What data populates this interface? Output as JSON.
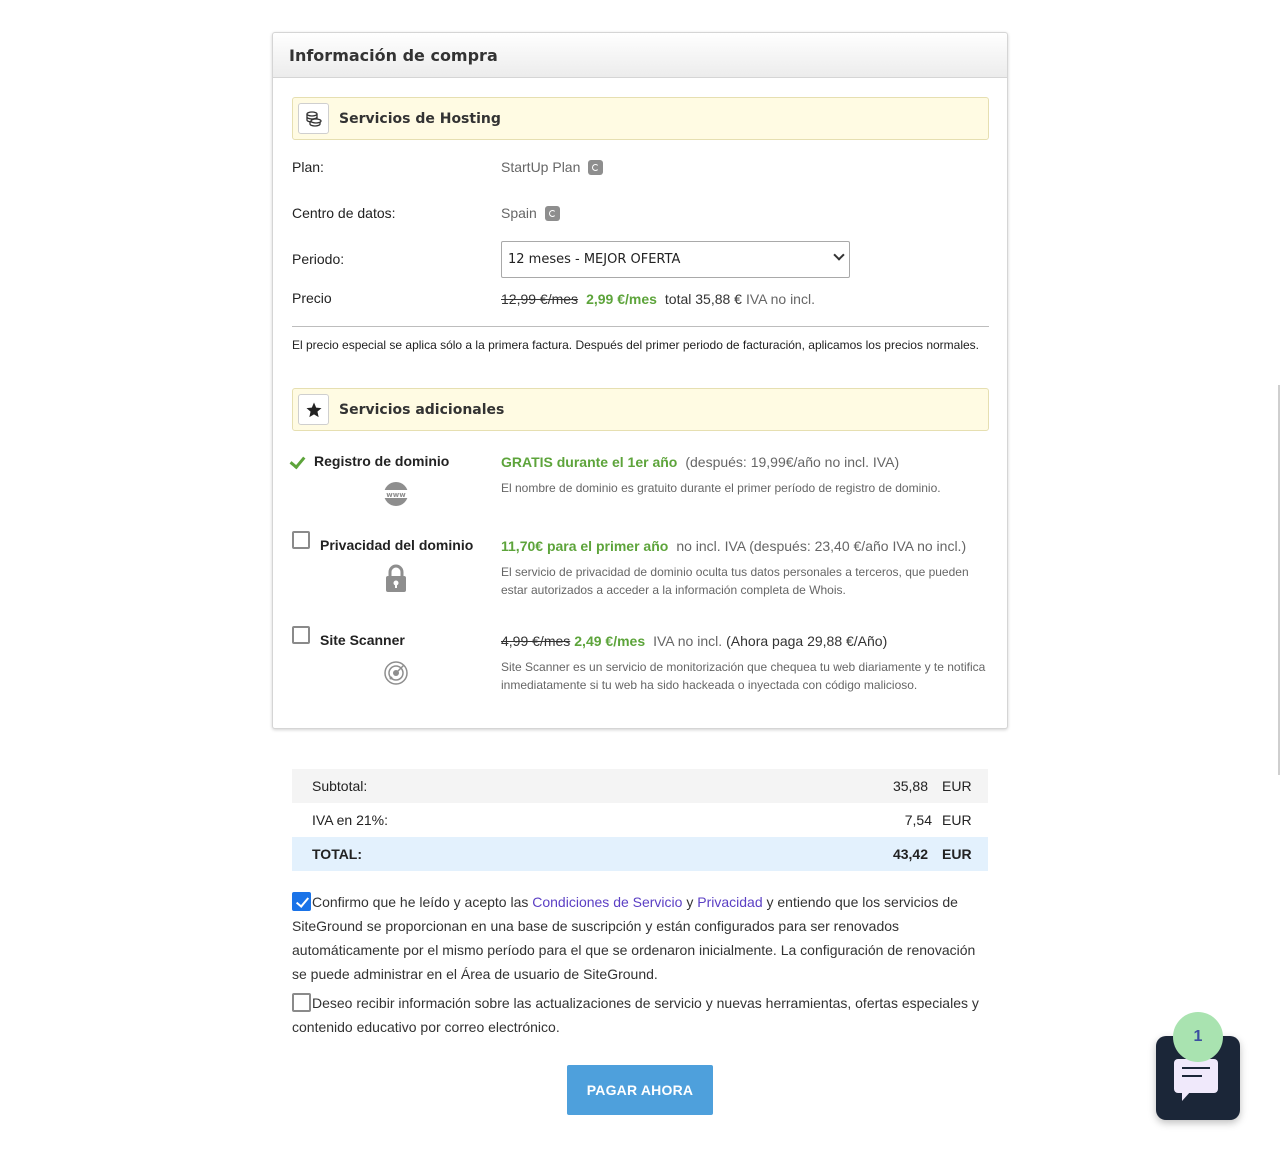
{
  "panel": {
    "title": "Información de compra"
  },
  "hosting": {
    "title": "Servicios de Hosting",
    "icon": "coins-icon",
    "plan_label": "Plan:",
    "plan_value": "StartUp Plan",
    "datacenter_label": "Centro de datos:",
    "datacenter_value": "Spain",
    "period_label": "Periodo:",
    "period_selected": "12 meses - MEJOR OFERTA",
    "price_label": "Precio",
    "old_price": "12,99 €/mes",
    "new_price": "2,99 €/mes",
    "total": "total 35,88 €",
    "vat_note": "IVA no incl.",
    "note": "El precio especial se aplica sólo a la primera factura. Después del primer periodo de facturación, aplicamos los precios normales."
  },
  "extras": {
    "title": "Servicios adicionales",
    "icon": "star-icon",
    "items": [
      {
        "name": "Registro de dominio",
        "icon": "www-icon",
        "checked": true,
        "highlight": "GRATIS durante el 1er año",
        "detail": "(después: 19,99€/año no incl. IVA)",
        "desc": "El nombre de dominio es gratuito durante el primer período de registro de dominio."
      },
      {
        "name": "Privacidad del dominio",
        "icon": "lock-icon",
        "checked": false,
        "highlight": "11,70€ para el primer año",
        "detail": "no incl. IVA (después: 23,40 €/año IVA no incl.)",
        "desc": "El servicio de privacidad de dominio oculta tus datos personales a terceros, que pueden estar autorizados a acceder a la información completa de Whois."
      },
      {
        "name": "Site Scanner",
        "icon": "radar-icon",
        "checked": false,
        "old_price": "4,99 €/mes",
        "highlight": "2,49 €/mes",
        "detail": "IVA no incl.",
        "detail2": "(Ahora paga 29,88 €/Año)",
        "desc": "Site Scanner es un servicio de monitorización que chequea tu web diariamente y te notifica inmediatamente si tu web ha sido hackeada o inyectada con código malicioso."
      }
    ]
  },
  "totals": {
    "subtotal_label": "Subtotal:",
    "subtotal_value": "35,88",
    "vat_label": "IVA en 21%:",
    "vat_value": "7,54",
    "total_label": "TOTAL:",
    "total_value": "43,42",
    "currency": "EUR"
  },
  "terms": {
    "agree_checked": true,
    "agree_prefix": "Confirmo que he leído y acepto las ",
    "tos_link": "Condiciones de Servicio",
    "and": " y ",
    "privacy_link": "Privacidad",
    "agree_suffix": " y entiendo que los servicios de SiteGround se proporcionan en una base de suscripción y están configurados para ser renovados automáticamente por el mismo período para el que se ordenaron inicialmente. La configuración de renovación se puede administrar en el Área de usuario de SiteGround.",
    "newsletter_checked": false,
    "newsletter_text": "Deseo recibir información sobre las actualizaciones de servicio y nuevas herramientas, ofertas especiales y contenido educativo por correo electrónico."
  },
  "pay_button": "PAGAR AHORA",
  "chat": {
    "badge": "1",
    "icon": "chat-icon"
  },
  "colors": {
    "accent_green": "#5da43b",
    "button_blue": "#4ea0dc",
    "link": "#5b3fc4",
    "section_bg": "#fffbe3"
  }
}
